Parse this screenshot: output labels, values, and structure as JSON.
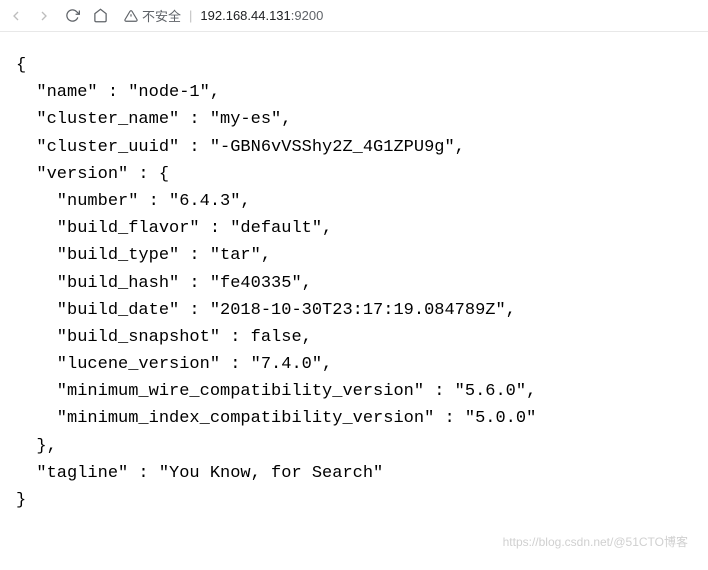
{
  "toolbar": {
    "security_label": "不安全",
    "url_host": "192.168.44.131",
    "url_port": ":9200"
  },
  "json_body": {
    "lines": [
      "{",
      "  \"name\" : \"node-1\",",
      "  \"cluster_name\" : \"my-es\",",
      "  \"cluster_uuid\" : \"-GBN6vVSShy2Z_4G1ZPU9g\",",
      "  \"version\" : {",
      "    \"number\" : \"6.4.3\",",
      "    \"build_flavor\" : \"default\",",
      "    \"build_type\" : \"tar\",",
      "    \"build_hash\" : \"fe40335\",",
      "    \"build_date\" : \"2018-10-30T23:17:19.084789Z\",",
      "    \"build_snapshot\" : false,",
      "    \"lucene_version\" : \"7.4.0\",",
      "    \"minimum_wire_compatibility_version\" : \"5.6.0\",",
      "    \"minimum_index_compatibility_version\" : \"5.0.0\"",
      "  },",
      "  \"tagline\" : \"You Know, for Search\"",
      "}"
    ]
  },
  "watermark": "https://blog.csdn.net/@51CTO博客"
}
